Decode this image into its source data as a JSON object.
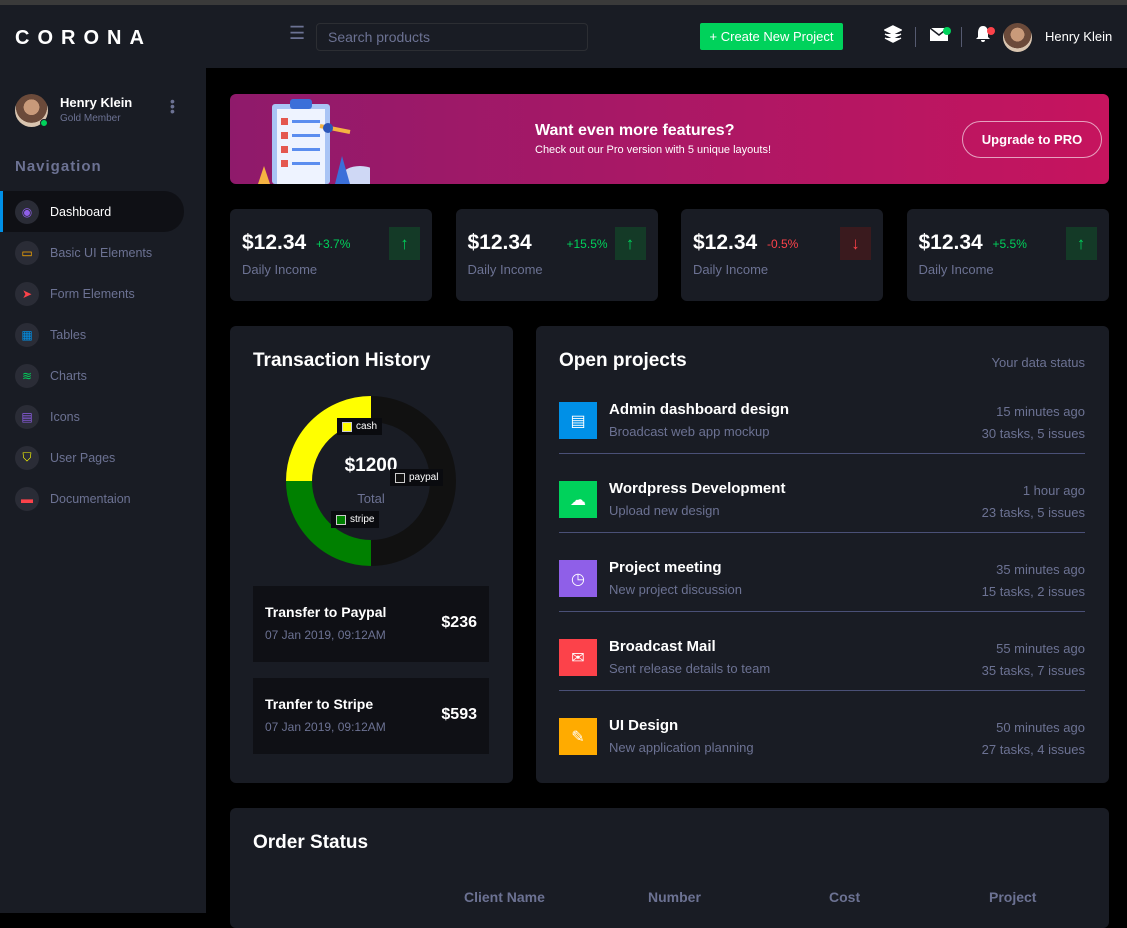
{
  "brand": "CORONA",
  "navbar": {
    "search_placeholder": "Search products",
    "create_label": "+ Create New Project",
    "user_name": "Henry Klein"
  },
  "profile": {
    "name": "Henry Klein",
    "rank": "Gold Member"
  },
  "nav_title": "Navigation",
  "nav": [
    {
      "label": "Dashboard",
      "icon": "compass-icon",
      "color": "#8f5fe8"
    },
    {
      "label": "Basic UI Elements",
      "icon": "laptop-icon",
      "color": "#ffab00"
    },
    {
      "label": "Form Elements",
      "icon": "navigation-icon",
      "color": "#fc424a"
    },
    {
      "label": "Tables",
      "icon": "calendar-icon",
      "color": "#0090e7"
    },
    {
      "label": "Charts",
      "icon": "layers-icon",
      "color": "#00d25b"
    },
    {
      "label": "Icons",
      "icon": "contacts-icon",
      "color": "#8f5fe8"
    },
    {
      "label": "User Pages",
      "icon": "shield-icon",
      "color": "#ffff00"
    },
    {
      "label": "Documentaion",
      "icon": "book-icon",
      "color": "#fc424a"
    }
  ],
  "banner": {
    "title": "Want even more features?",
    "subtitle": "Check out our Pro version with 5 unique layouts!",
    "button": "Upgrade to PRO"
  },
  "stats": [
    {
      "amount": "$12.34",
      "change": "+3.7%",
      "label": "Daily Income",
      "trend": "up"
    },
    {
      "amount": "$12.34",
      "change": "+15.5%",
      "label": "Daily Income",
      "trend": "up"
    },
    {
      "amount": "$12.34",
      "change": "-0.5%",
      "label": "Daily Income",
      "trend": "down"
    },
    {
      "amount": "$12.34",
      "change": "+5.5%",
      "label": "Daily Income",
      "trend": "up"
    }
  ],
  "transactions": {
    "title": "Transaction History",
    "total": "$1200",
    "total_label": "Total",
    "chart_data": {
      "type": "pie",
      "categories": [
        "paypal",
        "stripe",
        "cash"
      ],
      "values": [
        50,
        25,
        25
      ],
      "colors": [
        "#111111",
        "#008000",
        "#ffff00"
      ]
    },
    "items": [
      {
        "title": "Transfer to Paypal",
        "date": "07 Jan 2019, 09:12AM",
        "amount": "$236"
      },
      {
        "title": "Tranfer to Stripe",
        "date": "07 Jan 2019, 09:12AM",
        "amount": "$593"
      }
    ]
  },
  "projects": {
    "title": "Open projects",
    "status": "Your data status",
    "items": [
      {
        "title": "Admin dashboard design",
        "sub": "Broadcast web app mockup",
        "time": "15 minutes ago",
        "tasks": "30 tasks, 5 issues",
        "color": "#0090e7",
        "icon": "file-icon",
        "glyph": "▤"
      },
      {
        "title": "Wordpress Development",
        "sub": "Upload new design",
        "time": "1 hour ago",
        "tasks": "23 tasks, 5 issues",
        "color": "#00d25b",
        "icon": "cloud-download-icon",
        "glyph": "☁"
      },
      {
        "title": "Project meeting",
        "sub": "New project discussion",
        "time": "35 minutes ago",
        "tasks": "15 tasks, 2 issues",
        "color": "#8f5fe8",
        "icon": "clock-icon",
        "glyph": "◷"
      },
      {
        "title": "Broadcast Mail",
        "sub": "Sent release details to team",
        "time": "55 minutes ago",
        "tasks": "35 tasks, 7 issues",
        "color": "#fc424a",
        "icon": "mail-icon",
        "glyph": "✉"
      },
      {
        "title": "UI Design",
        "sub": "New application planning",
        "time": "50 minutes ago",
        "tasks": "27 tasks, 4 issues",
        "color": "#ffab00",
        "icon": "brush-icon",
        "glyph": "✎"
      }
    ]
  },
  "orders": {
    "title": "Order Status",
    "columns": [
      "Client Name",
      "Number",
      "Cost",
      "Project"
    ]
  }
}
